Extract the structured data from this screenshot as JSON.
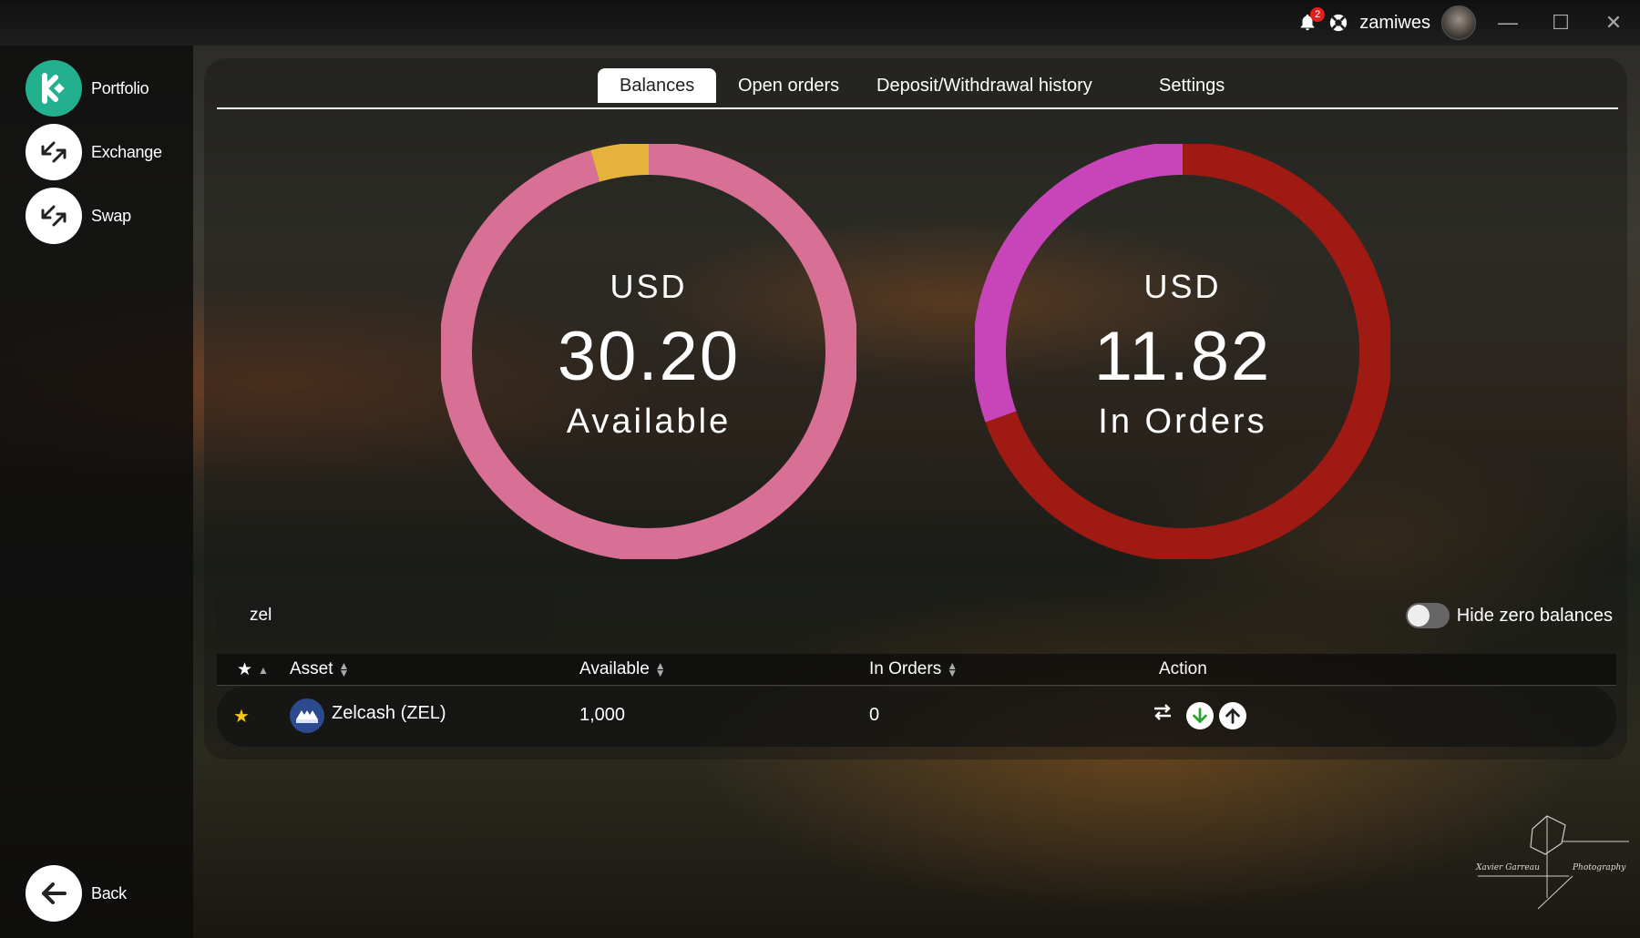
{
  "titlebar": {
    "notification_count": "2",
    "username": "zamiwes",
    "minimize": "—",
    "maximize": "☐",
    "close": "✕"
  },
  "sidebar": {
    "items": [
      {
        "label": "Portfolio",
        "icon": "kucoin-logo-icon"
      },
      {
        "label": "Exchange",
        "icon": "exchange-arrows-icon"
      },
      {
        "label": "Swap",
        "icon": "swap-arrows-icon"
      }
    ],
    "back": {
      "label": "Back",
      "icon": "arrow-left-icon"
    }
  },
  "tabs": [
    {
      "label": "Balances",
      "active": true
    },
    {
      "label": "Open orders",
      "active": false
    },
    {
      "label": "Deposit/Withdrawal history",
      "active": false
    },
    {
      "label": "Settings",
      "active": false
    }
  ],
  "charts": {
    "available": {
      "currency": "USD",
      "value": "30.20",
      "label": "Available",
      "segments": [
        {
          "fraction": 0.955,
          "color": "#d87095"
        },
        {
          "fraction": 0.045,
          "color": "#e5b33c"
        }
      ]
    },
    "in_orders": {
      "currency": "USD",
      "value": "11.82",
      "label": "In Orders",
      "segments": [
        {
          "fraction": 0.695,
          "color": "#9e1a12"
        },
        {
          "fraction": 0.305,
          "color": "#c845b9"
        }
      ]
    }
  },
  "filter": {
    "search_value": "zel",
    "hide_zero_label": "Hide zero balances",
    "hide_zero_enabled": false
  },
  "table": {
    "headers": {
      "asset": "Asset",
      "available": "Available",
      "in_orders": "In Orders",
      "action": "Action"
    },
    "rows": [
      {
        "favorite": true,
        "asset": "Zelcash (ZEL)",
        "available": "1,000",
        "in_orders": "0"
      }
    ]
  },
  "watermark": {
    "left": "Xavier Garreau",
    "right": "Photography"
  },
  "colors": {
    "accent": "#23b08e",
    "deposit": "#2aa52a",
    "star": "#f5c518"
  }
}
